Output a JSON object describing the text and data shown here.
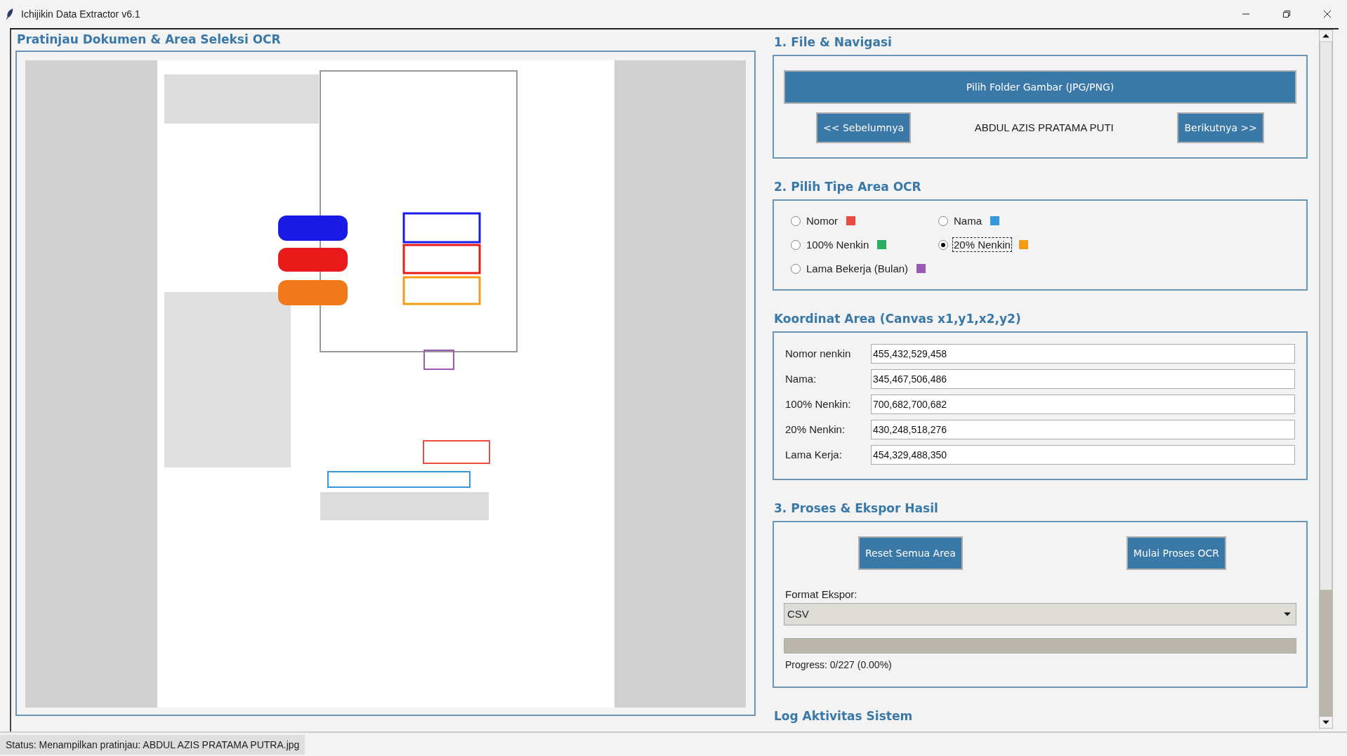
{
  "window": {
    "title": "Ichijikin Data Extractor v6.1"
  },
  "preview": {
    "heading": "Pratinjau Dokumen & Area Seleksi OCR"
  },
  "file_nav": {
    "heading": "1. File & Navigasi",
    "folder_button": "Pilih Folder Gambar (JPG/PNG)",
    "prev_button": "<< Sebelumnya",
    "current_name": "ABDUL AZIS PRATAMA PUTI",
    "next_button": "Berikutnya >>"
  },
  "area_type": {
    "heading": "2. Pilih Tipe Area OCR",
    "options": [
      {
        "label": "Nomor",
        "color": "#e74c3c",
        "selected": false
      },
      {
        "label": "Nama",
        "color": "#3498db",
        "selected": false
      },
      {
        "label": "100% Nenkin",
        "color": "#27ae60",
        "selected": false
      },
      {
        "label": "20% Nenkin",
        "color": "#f39c12",
        "selected": true
      },
      {
        "label": "Lama Bekerja (Bulan)",
        "color": "#9b59b6",
        "selected": false
      }
    ]
  },
  "coordinates": {
    "heading": "Koordinat Area (Canvas x1,y1,x2,y2)",
    "fields": [
      {
        "label": "Nomor nenkin",
        "value": "455,432,529,458"
      },
      {
        "label": "Nama:",
        "value": "345,467,506,486"
      },
      {
        "label": "100% Nenkin:",
        "value": "700,682,700,682"
      },
      {
        "label": "20% Nenkin:",
        "value": "430,248,518,276"
      },
      {
        "label": "Lama Kerja:",
        "value": "454,329,488,350"
      }
    ]
  },
  "process": {
    "heading": "3. Proses & Ekspor Hasil",
    "reset_button": "Reset Semua Area",
    "start_button": "Mulai Proses OCR",
    "format_label": "Format Ekspor:",
    "format_value": "CSV",
    "progress": {
      "level": 0
    },
    "progress_text": "Progress: 0/227 (0.00%)"
  },
  "log": {
    "heading": "Log Aktivitas Sistem"
  },
  "status_bar": "Status: Menampilkan pratinjau: ABDUL AZIS PRATAMA PUTRA.jpg"
}
